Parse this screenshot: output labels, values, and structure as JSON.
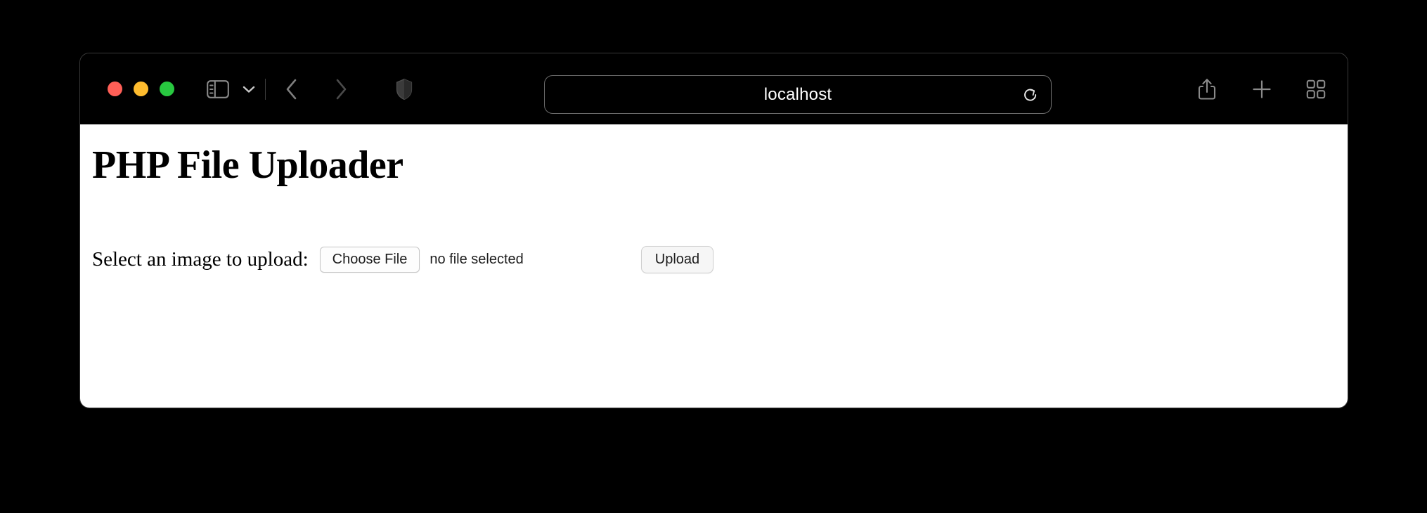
{
  "window": {
    "traffic_lights": [
      {
        "name": "close",
        "color": "#FF5F57"
      },
      {
        "name": "minimize",
        "color": "#FEBC2E"
      },
      {
        "name": "maximize",
        "color": "#28C840"
      }
    ]
  },
  "toolbar": {
    "sidebar_toggle_icon": "sidebar-icon",
    "sidebar_chevron_icon": "chevron-down-icon",
    "back_icon": "chevron-left-icon",
    "forward_icon": "chevron-right-icon",
    "shield_icon": "shield-icon",
    "share_icon": "share-icon",
    "new_tab_icon": "plus-icon",
    "tab_overview_icon": "grid-icon",
    "icon_color": "#8a8a8a",
    "icon_color_dim": "#4a4a4a"
  },
  "address_bar": {
    "url": "localhost",
    "reload_icon": "reload-icon",
    "text_color": "#ffffff"
  },
  "page": {
    "title": "PHP File Uploader",
    "form": {
      "label": "Select an image to upload:",
      "choose_file_label": "Choose File",
      "file_status": "no file selected",
      "submit_label": "Upload"
    },
    "background": "#ffffff"
  }
}
